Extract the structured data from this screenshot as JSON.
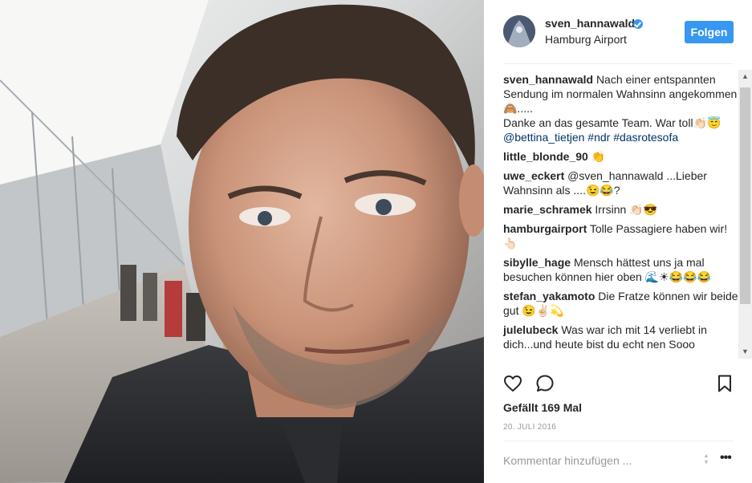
{
  "post": {
    "photo_alt": "",
    "header": {
      "username": "sven_hannawald",
      "location": "Hamburg Airport",
      "follow_label": "Folgen"
    },
    "caption": {
      "author": "sven_hannawald",
      "lines": [
        "Nach einer entspannten Sendung im normalen Wahnsinn angekommen🙈.....",
        "Danke an das gesamte Team. War toll👏🏻😇",
        "@bettina_tietjen #ndr #dasrotesofa"
      ]
    },
    "comments": [
      {
        "author": "little_blonde_90",
        "text": "👏"
      },
      {
        "author": "uwe_eckert",
        "text": "@sven_hannawald ...Lieber Wahnsinn als ....😉😂?"
      },
      {
        "author": "marie_schramek",
        "text": "Irrsinn 👏🏻😎"
      },
      {
        "author": "hamburgairport",
        "text": "Tolle Passagiere haben wir! 👆🏻"
      },
      {
        "author": "sibylle_hage",
        "text": "Mensch hättest uns ja mal besuchen können hier oben 🌊☀😂😂😂"
      },
      {
        "author": "stefan_yakamoto",
        "text": "Die Fratze können wir beide gut 😉✌🏻💫"
      },
      {
        "author": "julelubeck",
        "text": "Was war ich mit 14 verliebt in dich...und heute bist du echt nen Sooo"
      }
    ],
    "likes_label": "Gefällt 169 Mal",
    "date": "20. JULI 2016",
    "comment_placeholder": "Kommentar hinzufügen ...",
    "accent_color": "#3897f0",
    "icons": {
      "like": "heart-icon",
      "comment": "speech-bubble-icon",
      "save": "bookmark-icon",
      "verified": "verified-badge-icon",
      "more": "ellipsis-icon"
    }
  }
}
